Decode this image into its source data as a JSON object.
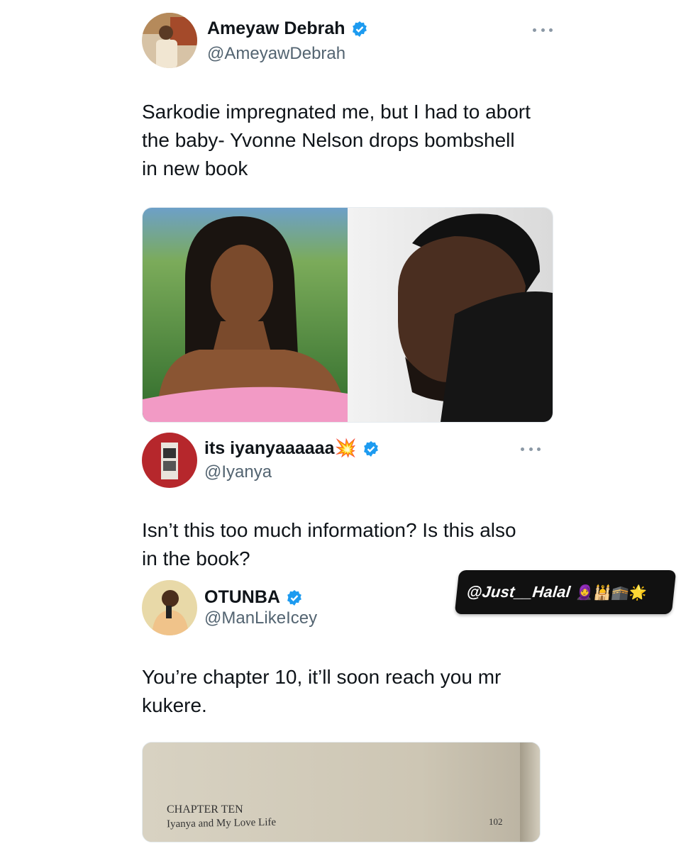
{
  "tweet1": {
    "name": "Ameyaw Debrah",
    "handle": "@AmeyawDebrah",
    "text_line1": "Sarkodie impregnated me, but I had to abort",
    "text_line2": "the baby- Yvonne Nelson drops bombshell",
    "text_line3": "in new book"
  },
  "tweet2": {
    "name": "its iyanyaaaaaa",
    "name_emoji": "💥",
    "handle": "@Iyanya",
    "text_line1": "Isn’t this too much information? Is this also",
    "text_line2": "in the book?"
  },
  "tweet3": {
    "name": "OTUNBA",
    "handle": "@ManLikeIcey",
    "text_line1": "You’re chapter 10, it’ll soon reach you mr",
    "text_line2": "kukere.",
    "book": {
      "chapter": "CHAPTER TEN",
      "subtitle": "Iyanya and My Love Life",
      "page": "102"
    }
  },
  "watermark": {
    "text": "@Just__Halal",
    "emojis": "🧕🕌🕋🌟"
  },
  "colors": {
    "verified": "#1d9bf0",
    "handle": "#536471",
    "text": "#0f1419"
  }
}
